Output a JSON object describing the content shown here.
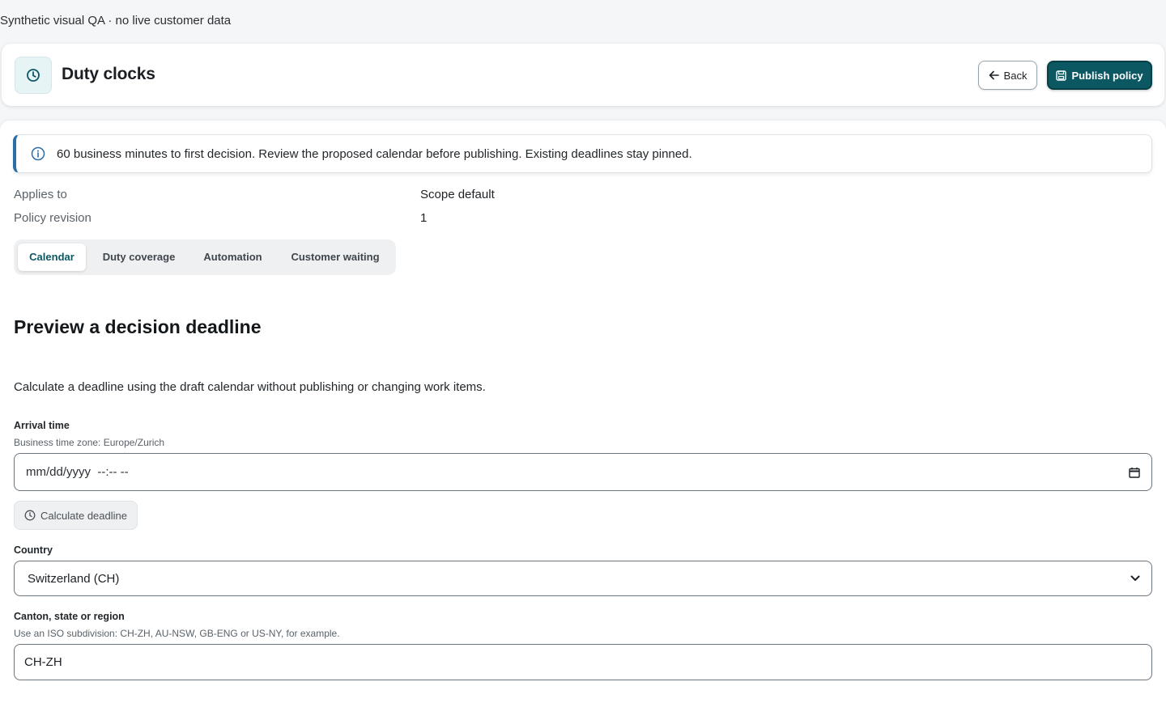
{
  "top_note": "Synthetic visual QA · no live customer data",
  "header": {
    "title": "Duty clocks",
    "logo_icon": "clock-icon",
    "back_label": "Back",
    "publish_label": "Publish policy",
    "accent_color": "#0b5863"
  },
  "info_banner": {
    "icon": "info-icon",
    "text": "60 business minutes to first decision. Review the proposed calendar before publishing. Existing deadlines stay pinned."
  },
  "meta": [
    {
      "label": "Applies to",
      "value": "Scope default"
    },
    {
      "label": "Policy revision",
      "value": "1"
    }
  ],
  "tabs": [
    {
      "label": "Calendar",
      "active": true
    },
    {
      "label": "Duty coverage",
      "active": false
    },
    {
      "label": "Automation",
      "active": false
    },
    {
      "label": "Customer waiting",
      "active": false
    }
  ],
  "preview": {
    "title": "Preview a decision deadline",
    "description": "Calculate a deadline using the draft calendar without publishing or changing work items.",
    "arrival": {
      "label": "Arrival time",
      "help": "Business time zone: Europe/Zurich",
      "placeholder": "mm/dd/yyyy  --:-- --"
    },
    "calculate_label": "Calculate deadline",
    "country": {
      "label": "Country",
      "value": "Switzerland (CH)"
    },
    "region": {
      "label": "Canton, state or region",
      "help": "Use an ISO subdivision: CH-ZH, AU-NSW, GB-ENG or US-NY, for example.",
      "value": "CH-ZH"
    }
  }
}
